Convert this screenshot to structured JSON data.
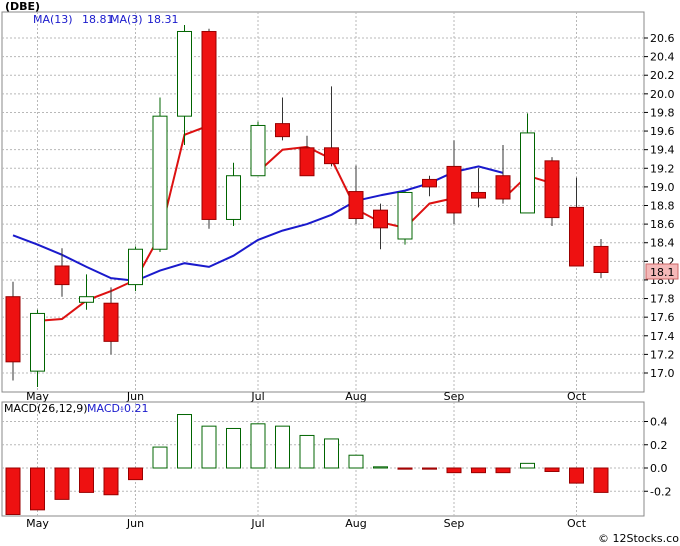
{
  "ticker_label": "(DBE)",
  "legend": {
    "ma13": {
      "label": "MA(13)",
      "value": "18.81",
      "color": "#1a1acc"
    },
    "ma3": {
      "label": "MA(3)",
      "value": "18.31",
      "color": "#cc1111"
    },
    "macd_params": {
      "label": "MACD(26,12,9)",
      "color": "#000000"
    },
    "macd_value": {
      "label": "MACD:",
      "value": "-0.21",
      "color": "#1a1acc"
    }
  },
  "last_price": "18.1",
  "watermark": "© 12Stocks.com",
  "colors": {
    "up": "#ffffff",
    "up_outline": "#006400",
    "down": "#ee1111",
    "down_outline": "#990000",
    "grid": "#b8b8b8",
    "price_tag": "#f4b8b8"
  },
  "chart_data": [
    {
      "type": "candlestick",
      "title": "",
      "x_labels": [
        "May",
        "Jun",
        "Jul",
        "Aug",
        "Sep",
        "Oct"
      ],
      "x_label_weeks": [
        1,
        5,
        10,
        14,
        18,
        23
      ],
      "ylim": [
        16.8,
        20.8
      ],
      "yticks": [
        "17.0",
        "17.2",
        "17.4",
        "17.6",
        "17.8",
        "18.0",
        "18.2",
        "18.4",
        "18.6",
        "18.8",
        "19.0",
        "19.2",
        "19.4",
        "19.6",
        "19.8",
        "20.0",
        "20.2",
        "20.4",
        "20.6"
      ],
      "grid": true,
      "candles": [
        {
          "open": 17.82,
          "high": 17.98,
          "low": 16.92,
          "close": 17.12
        },
        {
          "open": 17.02,
          "high": 17.68,
          "low": 16.85,
          "close": 17.64
        },
        {
          "open": 18.15,
          "high": 18.34,
          "low": 17.82,
          "close": 17.95
        },
        {
          "open": 17.76,
          "high": 18.06,
          "low": 17.68,
          "close": 17.82
        },
        {
          "open": 17.75,
          "high": 17.92,
          "low": 17.2,
          "close": 17.34
        },
        {
          "open": 17.95,
          "high": 18.36,
          "low": 17.88,
          "close": 18.33
        },
        {
          "open": 18.33,
          "high": 19.96,
          "low": 18.3,
          "close": 19.76
        },
        {
          "open": 19.76,
          "high": 20.74,
          "low": 19.45,
          "close": 20.67
        },
        {
          "open": 20.67,
          "high": 20.7,
          "low": 18.55,
          "close": 18.65
        },
        {
          "open": 18.65,
          "high": 19.26,
          "low": 18.58,
          "close": 19.12
        },
        {
          "open": 19.12,
          "high": 19.7,
          "low": 19.12,
          "close": 19.66
        },
        {
          "open": 19.68,
          "high": 19.96,
          "low": 19.5,
          "close": 19.54
        },
        {
          "open": 19.42,
          "high": 19.55,
          "low": 19.12,
          "close": 19.12
        },
        {
          "open": 19.42,
          "high": 20.08,
          "low": 19.22,
          "close": 19.25
        },
        {
          "open": 18.95,
          "high": 19.23,
          "low": 18.6,
          "close": 18.66
        },
        {
          "open": 18.75,
          "high": 18.82,
          "low": 18.33,
          "close": 18.56
        },
        {
          "open": 18.44,
          "high": 18.95,
          "low": 18.38,
          "close": 18.94
        },
        {
          "open": 19.08,
          "high": 19.12,
          "low": 18.9,
          "close": 19.0
        },
        {
          "open": 19.22,
          "high": 19.5,
          "low": 18.6,
          "close": 18.72
        },
        {
          "open": 18.94,
          "high": 19.2,
          "low": 18.78,
          "close": 18.88
        },
        {
          "open": 19.12,
          "high": 19.45,
          "low": 18.82,
          "close": 18.87
        },
        {
          "open": 18.72,
          "high": 19.79,
          "low": 18.72,
          "close": 19.58
        },
        {
          "open": 19.28,
          "high": 19.32,
          "low": 18.58,
          "close": 18.67
        },
        {
          "open": 18.78,
          "high": 19.1,
          "low": 18.15,
          "close": 18.15
        },
        {
          "open": 18.36,
          "high": 18.44,
          "low": 18.02,
          "close": 18.08
        }
      ],
      "series": [
        {
          "name": "MA(13)",
          "values": [
            null,
            17.56,
            17.58,
            17.78,
            17.88,
            18.0,
            18.48,
            19.56,
            19.66,
            null,
            19.16,
            19.4,
            19.43,
            19.3,
            18.76,
            18.62,
            18.56,
            18.82,
            18.88,
            null,
            18.87,
            19.12,
            19.04,
            null,
            null
          ]
        },
        {
          "name": "MA(3)",
          "values": [
            18.48,
            18.38,
            18.27,
            18.14,
            18.02,
            17.99,
            18.1,
            18.18,
            18.14,
            18.26,
            18.43,
            18.53,
            18.6,
            18.7,
            18.85,
            18.91,
            18.96,
            19.04,
            19.16,
            19.22,
            19.15,
            null,
            null,
            null,
            null
          ]
        }
      ]
    },
    {
      "type": "bar",
      "title": "MACD(26,12,9)",
      "ylim": [
        -0.41,
        0.55
      ],
      "yticks": [
        "-0.2",
        "0.0",
        "0.2",
        "0.4"
      ],
      "values": [
        -0.4,
        -0.36,
        -0.27,
        -0.21,
        -0.23,
        -0.1,
        0.18,
        0.46,
        0.36,
        0.34,
        0.38,
        0.36,
        0.28,
        0.25,
        0.11,
        0.01,
        -0.01,
        -0.01,
        -0.04,
        -0.04,
        -0.04,
        0.04,
        -0.03,
        -0.13,
        -0.21
      ]
    }
  ]
}
